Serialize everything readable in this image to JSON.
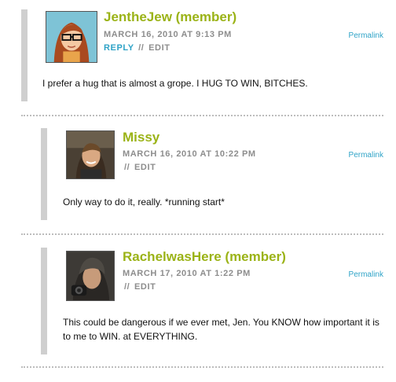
{
  "comments": [
    {
      "author": "JentheJew (member)",
      "date": "MARCH 16, 2010 AT 9:13 PM",
      "reply_label": "REPLY",
      "separator": "//",
      "edit_label": "EDIT",
      "permalink_label": "Permalink",
      "text": "I prefer a hug that is almost a grope. I HUG TO WIN, BITCHES.",
      "avatar_icon": "cartoon-woman-glasses-avatar"
    },
    {
      "author": "Missy",
      "date": "MARCH 16, 2010 AT 10:22 PM",
      "separator": "//",
      "edit_label": "EDIT",
      "permalink_label": "Permalink",
      "text": "Only way to do it, really. *running start*",
      "avatar_icon": "photo-avatar"
    },
    {
      "author": "RachelwasHere (member)",
      "date": "MARCH 17, 2010 AT 1:22 PM",
      "separator": "//",
      "edit_label": "EDIT",
      "permalink_label": "Permalink",
      "text": "This could be dangerous if we ever met, Jen. You KNOW how important it is to me to WIN. at EVERYTHING.",
      "avatar_icon": "photo-avatar"
    }
  ],
  "colors": {
    "author": "#9bb317",
    "link": "#2fa3c7",
    "meta": "#8d8d8d",
    "bar": "#cfcfcf"
  }
}
